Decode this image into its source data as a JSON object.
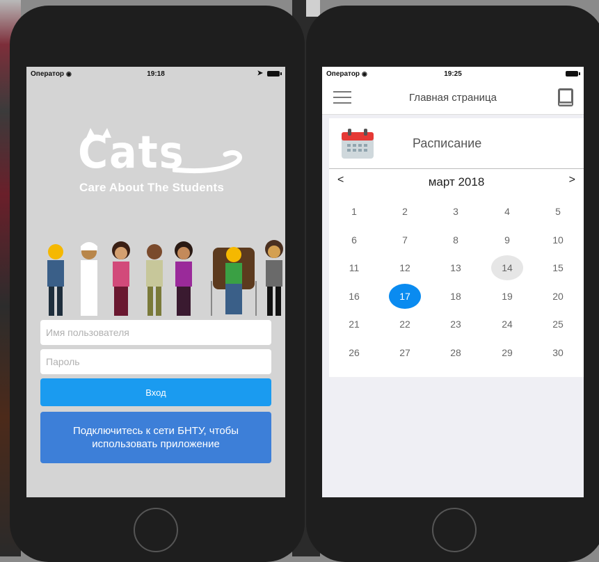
{
  "left_screen": {
    "status": {
      "carrier": "Оператор",
      "wifi": "📶",
      "time": "19:18",
      "location": "➤"
    },
    "logo": {
      "title": "Cats",
      "subtitle": "Care About The Students"
    },
    "username_placeholder": "Имя пользователя",
    "password_placeholder": "Пароль",
    "login_label": "Вход",
    "notice": "Подключитесь к сети БНТУ, чтобы использовать приложение"
  },
  "right_screen": {
    "status": {
      "carrier": "Оператор",
      "wifi": "📶",
      "time": "19:25"
    },
    "nav_title": "Главная страница",
    "card_title": "Расписание",
    "calendar": {
      "prev": "<",
      "next": ">",
      "month": "март 2018",
      "days": [
        [
          "1",
          "2",
          "3",
          "4",
          "5"
        ],
        [
          "6",
          "7",
          "8",
          "9",
          "10"
        ],
        [
          "11",
          "12",
          "13",
          "14",
          "15"
        ],
        [
          "16",
          "17",
          "18",
          "19",
          "20"
        ],
        [
          "21",
          "22",
          "23",
          "24",
          "25"
        ],
        [
          "26",
          "27",
          "28",
          "29",
          "30"
        ]
      ],
      "today": "14",
      "selected": "17"
    },
    "colors": {
      "selected": "#0a8bf0",
      "today": "#e6e6e6"
    }
  },
  "icons": [
    "wifi-icon",
    "location-icon",
    "battery-icon",
    "hamburger-icon",
    "book-icon",
    "calendar-icon",
    "home-button"
  ]
}
